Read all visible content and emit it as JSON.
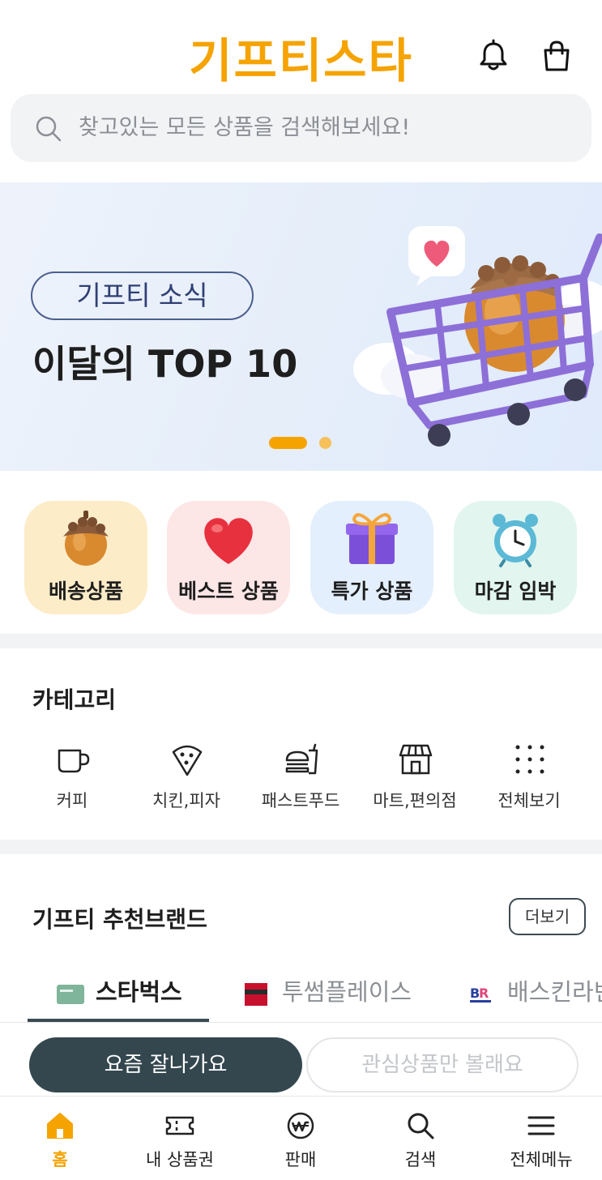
{
  "header": {
    "logo_text": "기프티스타",
    "icons": [
      "bell-icon",
      "shopping-bag-icon"
    ]
  },
  "search": {
    "placeholder": "찾고있는 모든 상품을 검색해보세요!",
    "icon": "search-icon"
  },
  "banner": {
    "tag": "기프티 소식",
    "title": "이달의 TOP 10",
    "pages_total": 2,
    "current_page": 1,
    "art": "shopping-cart-acorn-illustration"
  },
  "quick_tiles": [
    {
      "label": "배송상품",
      "icon": "acorn-icon"
    },
    {
      "label": "베스트 상품",
      "icon": "heart-icon"
    },
    {
      "label": "특가 상품",
      "icon": "gift-box-icon"
    },
    {
      "label": "마감 임박",
      "icon": "alarm-clock-icon"
    }
  ],
  "category": {
    "title": "카테고리",
    "items": [
      {
        "label": "커피",
        "icon": "coffee-cup-icon"
      },
      {
        "label": "치킨,피자",
        "icon": "pizza-slice-icon"
      },
      {
        "label": "패스트푸드",
        "icon": "burger-drink-icon"
      },
      {
        "label": "마트,편의점",
        "icon": "store-icon"
      },
      {
        "label": "전체보기",
        "icon": "grid-dots-icon"
      }
    ]
  },
  "brands": {
    "title": "기프티 추천브랜드",
    "more_label": "더보기",
    "tabs": [
      {
        "label": "스타벅스",
        "icon": "starbucks-card-icon",
        "active": true
      },
      {
        "label": "투썸플레이스",
        "icon": "twosome-logo-icon",
        "active": false
      },
      {
        "label": "배스킨라빈스",
        "icon": "baskin-robbins-logo-icon",
        "active": false
      }
    ],
    "segments": {
      "active": "요즘 잘나가요",
      "inactive": "관심상품만 볼래요"
    }
  },
  "bottom_nav": [
    {
      "label": "홈",
      "icon": "home-icon",
      "active": true
    },
    {
      "label": "내 상품권",
      "icon": "ticket-icon",
      "active": false
    },
    {
      "label": "판매",
      "icon": "won-coin-icon",
      "active": false
    },
    {
      "label": "검색",
      "icon": "search-icon",
      "active": false
    },
    {
      "label": "전체메뉴",
      "icon": "hamburger-menu-icon",
      "active": false
    }
  ],
  "colors": {
    "brand_orange": "#f5a300",
    "dark_slate": "#34474f",
    "banner_bg": "#e6eefa",
    "search_bg": "#f2f3f5"
  }
}
